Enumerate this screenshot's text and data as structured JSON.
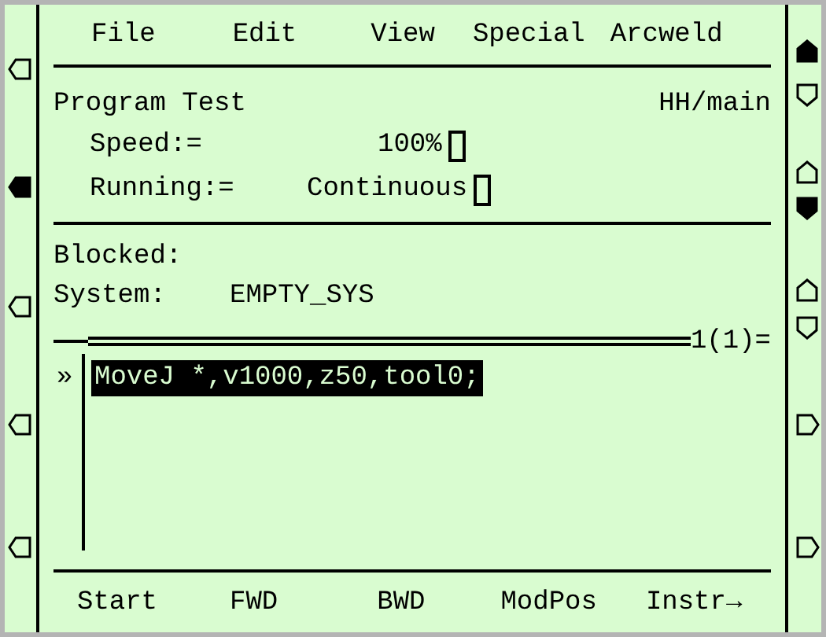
{
  "menu": [
    {
      "label": "File"
    },
    {
      "label": "Edit"
    },
    {
      "label": "View"
    },
    {
      "label": "Special"
    },
    {
      "label": "Arcweld"
    }
  ],
  "status": {
    "title": "Program Test",
    "module": "HH/main",
    "fields": [
      {
        "label": "Speed:=",
        "value": "100%"
      },
      {
        "label": "Running:=",
        "value": "Continuous"
      }
    ]
  },
  "info": [
    {
      "label": "Blocked:"
    },
    {
      "label": "System:",
      "value": "EMPTY_SYS"
    }
  ],
  "program": {
    "position": "1(1)=",
    "lines": [
      {
        "pointer": "»",
        "code": "MoveJ *,v1000,z50,tool0;",
        "selected": true
      }
    ]
  },
  "softkeys": [
    {
      "label": "Start"
    },
    {
      "label": "FWD"
    },
    {
      "label": "BWD"
    },
    {
      "label": "ModPos"
    },
    {
      "label": "Instr→"
    }
  ],
  "left_indicators": [
    {
      "filled": false
    },
    {
      "filled": true
    },
    {
      "filled": false
    },
    {
      "filled": false
    },
    {
      "filled": false
    }
  ],
  "right_indicators": [
    {
      "kind": "up",
      "filled": true
    },
    {
      "kind": "down",
      "filled": false
    },
    {
      "kind": "up",
      "filled": false
    },
    {
      "kind": "down",
      "filled": true
    },
    {
      "kind": "up",
      "filled": false
    },
    {
      "kind": "down",
      "filled": false
    },
    {
      "kind": "right",
      "filled": false
    },
    {
      "kind": "right",
      "filled": false
    }
  ]
}
